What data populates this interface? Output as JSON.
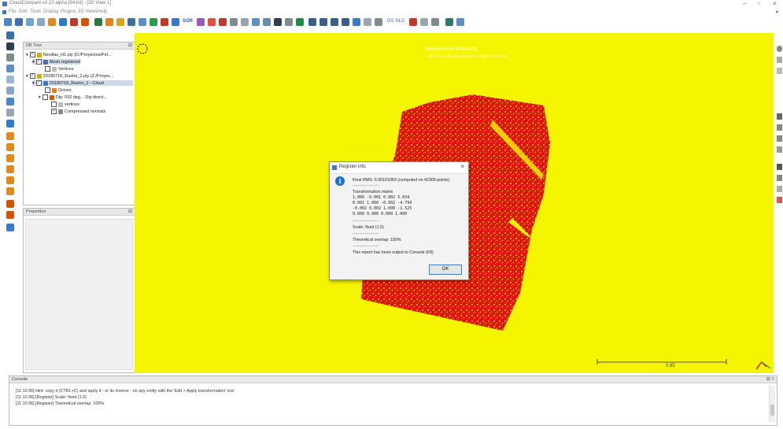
{
  "app": {
    "title": "CloudCompare v2.10 alpha [64-bit] - [3D View 1]"
  },
  "menu": [
    "File",
    "Edit",
    "Tools",
    "Display",
    "Plugins",
    "3D Views",
    "Help"
  ],
  "toolbar_sor": "SOR",
  "toolbar_gs": "GS NLS",
  "db_tree": {
    "header": "DB Tree",
    "items": [
      {
        "label": "Nevillas_H1.ply (D:/Proyectos/Pel..."
      },
      {
        "label": "Mesh.registered"
      },
      {
        "label": "Vertices"
      },
      {
        "label": "20180718_Rastro_2.ply (Z:/Proyec..."
      },
      {
        "label": "20180718_Rastro_2 - Cloud"
      },
      {
        "label": "Octree"
      },
      {
        "label": "Dip: 032 deg. - Dip direct..."
      },
      {
        "label": "vertices"
      },
      {
        "label": "Compressed normals"
      }
    ]
  },
  "properties": {
    "header": "Properties"
  },
  "view": {
    "segmentation": "Segmentation [PAUSED]",
    "segmentation_hint": "Left click: add contour points / Right click: stop",
    "scale_label": "0.65",
    "bg_color": "#f6f500",
    "points_color": "#e0140f"
  },
  "dialog": {
    "title": "Register info",
    "rms": "Final RMS: 0.00101063 (computed on 42309 points)",
    "sep": "-------------------",
    "matrix_label": "Transformation matrix",
    "matrix": [
      "1.000   -0.001  0.002   5.034",
      "0.001   1.000   -0.002  -4.794",
      "-0.002  0.002   1.000   -1.525",
      "0.000   0.000   0.000   1.000"
    ],
    "scale": "Scale: fixed (1.0)",
    "overlap": "Theoretical overlap: 100%",
    "report": "This report has been output to Console (F8)",
    "ok": "OK"
  },
  "console": {
    "header": "Console",
    "lines": [
      "[11:10:36] Hint: copy it (CTRL+C) and apply it - or its inverse - on any entity with the 'Edit > Apply transformation' tool",
      "[11:10:36] [Register] Scale: fixed (1.0)",
      "[11:10:36] [Register] Theoretical overlap: 100%"
    ]
  }
}
